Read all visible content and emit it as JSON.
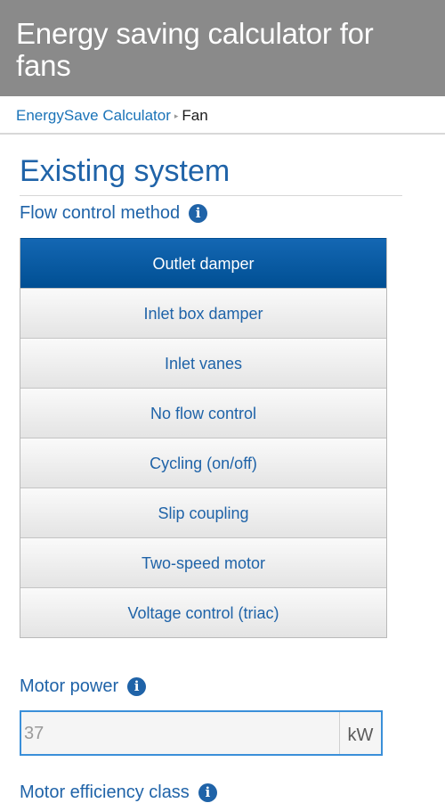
{
  "header": {
    "title": "Energy saving calculator for fans"
  },
  "breadcrumb": {
    "parent": "EnergySave Calculator",
    "separator": "▸",
    "current": "Fan"
  },
  "section": {
    "title": "Existing system"
  },
  "flow_control": {
    "label": "Flow control method",
    "info_icon": "info-icon",
    "selected": "Outlet damper",
    "options": [
      "Outlet damper",
      "Inlet box damper",
      "Inlet vanes",
      "No flow control",
      "Cycling (on/off)",
      "Slip coupling",
      "Two-speed motor",
      "Voltage control (triac)"
    ]
  },
  "motor_power": {
    "label": "Motor power",
    "placeholder": "37",
    "value": "",
    "unit": "kW"
  },
  "motor_efficiency": {
    "label": "Motor efficiency class"
  },
  "colors": {
    "header_bg": "#8a8a8a",
    "accent": "#1f63a8",
    "selected_bg": "#0058a0"
  }
}
